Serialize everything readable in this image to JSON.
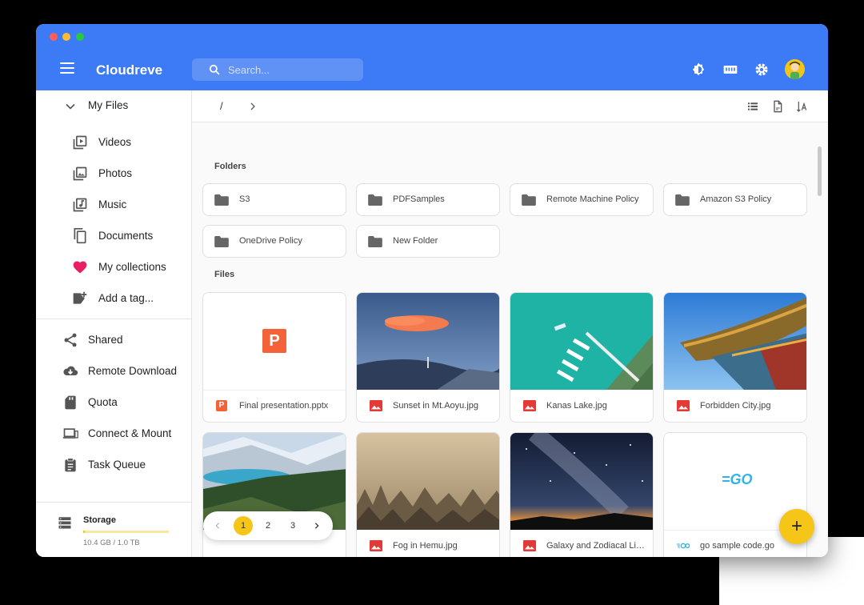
{
  "app": {
    "title": "Cloudreve"
  },
  "search": {
    "placeholder": "Search..."
  },
  "sidebar": {
    "my_files": "My Files",
    "items": [
      {
        "label": "Videos",
        "icon": "video-icon"
      },
      {
        "label": "Photos",
        "icon": "photo-icon"
      },
      {
        "label": "Music",
        "icon": "music-icon"
      },
      {
        "label": "Documents",
        "icon": "documents-icon"
      },
      {
        "label": "My collections",
        "icon": "heart-icon"
      },
      {
        "label": "Add a tag...",
        "icon": "add-tag-icon"
      }
    ],
    "nav": [
      {
        "label": "Shared",
        "icon": "share-icon"
      },
      {
        "label": "Remote Download",
        "icon": "cloud-download-icon"
      },
      {
        "label": "Quota",
        "icon": "sd-card-icon"
      },
      {
        "label": "Connect & Mount",
        "icon": "laptop-icon"
      },
      {
        "label": "Task Queue",
        "icon": "clipboard-icon"
      }
    ],
    "storage": {
      "label": "Storage",
      "used": "10.4 GB / 1.0 TB",
      "fraction": 0.0104
    }
  },
  "breadcrumb": {
    "root": "/"
  },
  "sections": {
    "folders": "Folders",
    "files": "Files"
  },
  "folders": [
    {
      "name": "S3"
    },
    {
      "name": "PDFSamples"
    },
    {
      "name": "Remote Machine Policy"
    },
    {
      "name": "Amazon S3 Policy"
    },
    {
      "name": "OneDrive Policy"
    },
    {
      "name": "New Folder"
    }
  ],
  "files": [
    {
      "name": "Final presentation.pptx",
      "type": "pptx"
    },
    {
      "name": "Sunset in Mt.Aoyu.jpg",
      "type": "image"
    },
    {
      "name": "Kanas Lake.jpg",
      "type": "image"
    },
    {
      "name": "Forbidden City.jpg",
      "type": "image"
    },
    {
      "name": "",
      "type": "image"
    },
    {
      "name": "Fog in Hemu.jpg",
      "type": "image"
    },
    {
      "name": "Galaxy and Zodiacal Light.jpg",
      "type": "image"
    },
    {
      "name": "go sample code.go",
      "type": "go"
    }
  ],
  "pagination": {
    "pages": [
      "1",
      "2",
      "3"
    ],
    "current": "1"
  },
  "fab": {
    "label": "+"
  },
  "go_logo": "=GO",
  "pptx_glyph": "P",
  "colors": {
    "accent": "#3d7af5",
    "secondary": "#f5c518",
    "heart": "#e91e63",
    "image_icon": "#e53935",
    "pptx": "#f4623a"
  }
}
